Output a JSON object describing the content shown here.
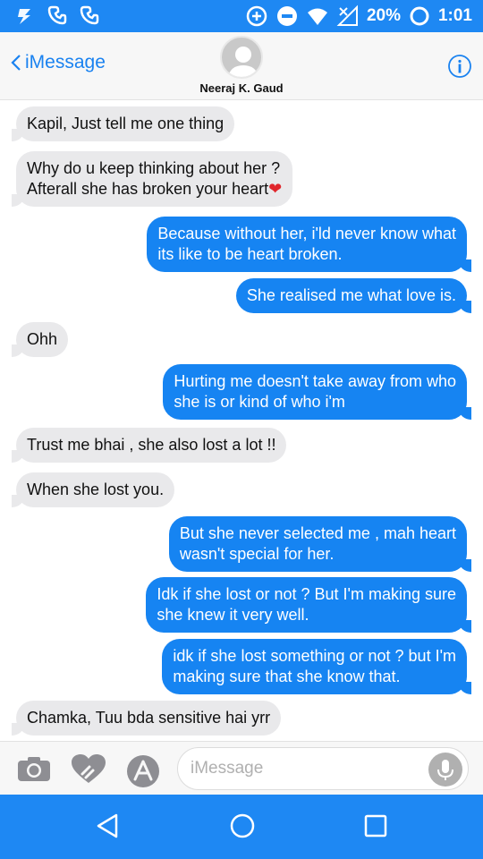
{
  "status_bar": {
    "battery": "20%",
    "time": "1:01",
    "icons": [
      "sync-icon",
      "phone-missed-icon",
      "phone-missed-icon",
      "add-circle-icon",
      "minus-circle-icon",
      "wifi-icon",
      "no-signal-icon",
      "battery-ring-icon"
    ]
  },
  "header": {
    "back_label": "iMessage",
    "contact_name": "Neeraj K. Gaud",
    "icons": [
      "chevron-left-icon",
      "avatar-icon",
      "info-icon"
    ]
  },
  "messages": [
    {
      "dir": "in",
      "lines": [
        "Kapil, Just tell me one thing"
      ]
    },
    {
      "dir": "in",
      "lines": [
        "Why do u keep thinking about her ?",
        "Afterall she has broken your heart"
      ],
      "emoji": "❤"
    },
    {
      "dir": "out",
      "lines": [
        "Because without her, i'ld never know what",
        "its like to be heart broken."
      ]
    },
    {
      "dir": "out",
      "lines": [
        "She realised me what love is."
      ]
    },
    {
      "dir": "in",
      "lines": [
        "Ohh"
      ]
    },
    {
      "dir": "out",
      "lines": [
        "Hurting me doesn't take away from who",
        "she is or kind of who i'm"
      ]
    },
    {
      "dir": "in",
      "lines": [
        "Trust me bhai ,  she also lost a lot !!"
      ]
    },
    {
      "dir": "in",
      "lines": [
        "When she lost you."
      ]
    },
    {
      "dir": "out",
      "lines": [
        "But she never selected me , mah heart",
        "wasn't special for her."
      ]
    },
    {
      "dir": "out",
      "lines": [
        "Idk if she lost or not ? But I'm making sure",
        "she knew it very well."
      ]
    },
    {
      "dir": "out",
      "lines": [
        "idk if she lost something or not ? but I'm",
        "making sure that she know that."
      ]
    },
    {
      "dir": "in",
      "lines": [
        "Chamka, Tuu bda sensitive hai yrr"
      ]
    }
  ],
  "composer": {
    "placeholder": "iMessage",
    "icons": [
      "camera-icon",
      "digital-touch-icon",
      "app-store-icon",
      "microphone-icon"
    ]
  },
  "android_nav": {
    "icons": [
      "back-triangle-icon",
      "home-circle-icon",
      "recents-square-icon"
    ]
  },
  "colors": {
    "accent": "#1e88f3",
    "outgoing_bubble": "#1684f2",
    "incoming_bubble": "#e9e9eb",
    "link": "#1a82f0"
  }
}
